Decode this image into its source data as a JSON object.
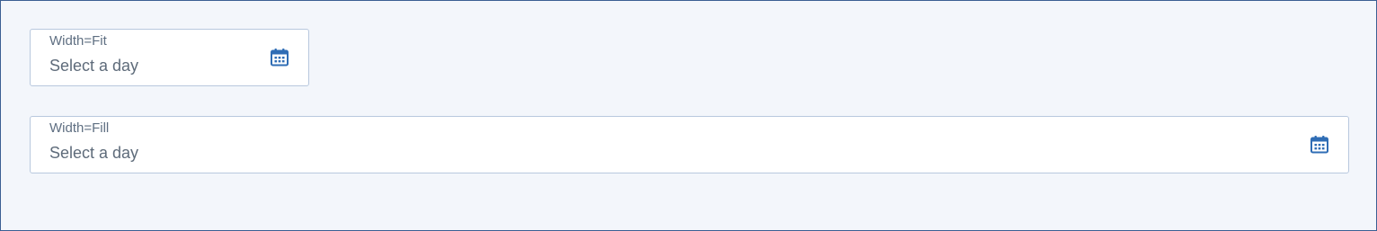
{
  "fields": [
    {
      "label": "Width=Fit",
      "placeholder": "Select a day",
      "icon": "calendar-icon"
    },
    {
      "label": "Width=Fill",
      "placeholder": "Select a day",
      "icon": "calendar-icon"
    }
  ],
  "colors": {
    "page_background": "#f3f6fb",
    "page_border": "#3b5f93",
    "field_border": "#b8c8de",
    "label_text": "#5f6f82",
    "placeholder_text": "#5e6b7a",
    "accent_icon": "#2f6db5"
  }
}
